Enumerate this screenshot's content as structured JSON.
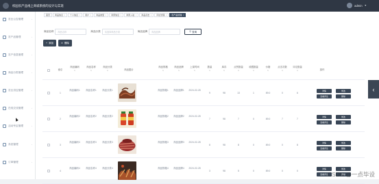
{
  "app": {
    "title": "校园农产品线上商城系统的设计与实现",
    "user": "admin"
  },
  "sidebar": {
    "items": [
      {
        "label": "农业公告管理",
        "icon": "bell-icon"
      },
      {
        "label": "农产品管理",
        "icon": "leaf-icon"
      },
      {
        "label": "农户信息管理",
        "icon": "user-icon"
      },
      {
        "label": "商品分类管理",
        "icon": "tag-icon"
      },
      {
        "label": "农业供应管理",
        "icon": "truck-icon"
      },
      {
        "label": "在线交流管理",
        "icon": "chat-icon"
      },
      {
        "label": "活动专区管理",
        "icon": "flag-icon"
      },
      {
        "label": "系统管理",
        "icon": "gear-icon"
      },
      {
        "label": "订单管理",
        "icon": "clipboard-icon"
      }
    ]
  },
  "tabs": [
    {
      "label": "首页"
    },
    {
      "label": "商品信息"
    },
    {
      "label": "个人信息"
    },
    {
      "label": "用户"
    },
    {
      "label": "商品类型"
    },
    {
      "label": "商家信息"
    },
    {
      "label": "商家入驻"
    },
    {
      "label": "商品点击"
    },
    {
      "label": "评论管理"
    },
    {
      "label": "农产品管理"
    }
  ],
  "search": {
    "label1": "商品名称",
    "placeholder1": "商品名称",
    "label2": "商品分类",
    "placeholder2": "请选择商品分类",
    "label3": "商品品牌",
    "placeholder3": "商品品牌",
    "button": "查询"
  },
  "actions": {
    "add": "添加",
    "delete": "删除"
  },
  "table": {
    "headers": [
      {
        "label": "索引"
      },
      {
        "label": "商品编码"
      },
      {
        "label": "商品名称"
      },
      {
        "label": "商品分类"
      },
      {
        "label": "商品图片"
      },
      {
        "label": "商品规格"
      },
      {
        "label": "商品品牌"
      },
      {
        "label": "上架时间"
      },
      {
        "label": "数量"
      },
      {
        "label": "库存"
      },
      {
        "label": "点赞数量"
      },
      {
        "label": "收藏数量"
      },
      {
        "label": "价格"
      },
      {
        "label": "点击次数"
      },
      {
        "label": "评论数量"
      },
      {
        "label": "操作"
      }
    ],
    "rows": [
      {
        "index": "1",
        "code": "商品编码1",
        "name": "商品名称1",
        "category": "商品分类1",
        "spec": "商品规格1",
        "brand": "商品品牌1",
        "date": "2024-02-28",
        "qty": "9",
        "stock": "98",
        "likes": "13",
        "favs": "1",
        "price": "89.0",
        "clicks": "0",
        "comments": "6"
      },
      {
        "index": "2",
        "code": "商品编码2",
        "name": "商品名称2",
        "category": "商品分类2",
        "spec": "商品规格2",
        "brand": "商品品牌2",
        "date": "2024-02-28",
        "qty": "7",
        "stock": "98",
        "likes": "7",
        "favs": "0",
        "price": "89.0",
        "clicks": "7",
        "comments": "7"
      },
      {
        "index": "3",
        "code": "商品编码3",
        "name": "商品名称3",
        "category": "商品分类3",
        "spec": "商品规格3",
        "brand": "商品品牌3",
        "date": "2024-02-28",
        "qty": "8",
        "stock": "98",
        "likes": "8",
        "favs": "0",
        "price": "89.0",
        "clicks": "0",
        "comments": "8"
      },
      {
        "index": "4",
        "code": "商品编码4",
        "name": "商品名称4",
        "category": "商品分类4",
        "spec": "商品规格4",
        "brand": "商品品牌4",
        "date": "2024-02-28",
        "qty": "3",
        "stock": "98",
        "likes": "5",
        "favs": "0",
        "price": "89.0",
        "clicks": "0",
        "comments": "0"
      }
    ],
    "ops": {
      "detail": "详情",
      "edit": "修改",
      "review": "查看评论",
      "delete": "删除"
    }
  },
  "watermark": "CSDN @一点毕设",
  "colors": {
    "dark": "#394656",
    "topbar": "#2f3744"
  }
}
